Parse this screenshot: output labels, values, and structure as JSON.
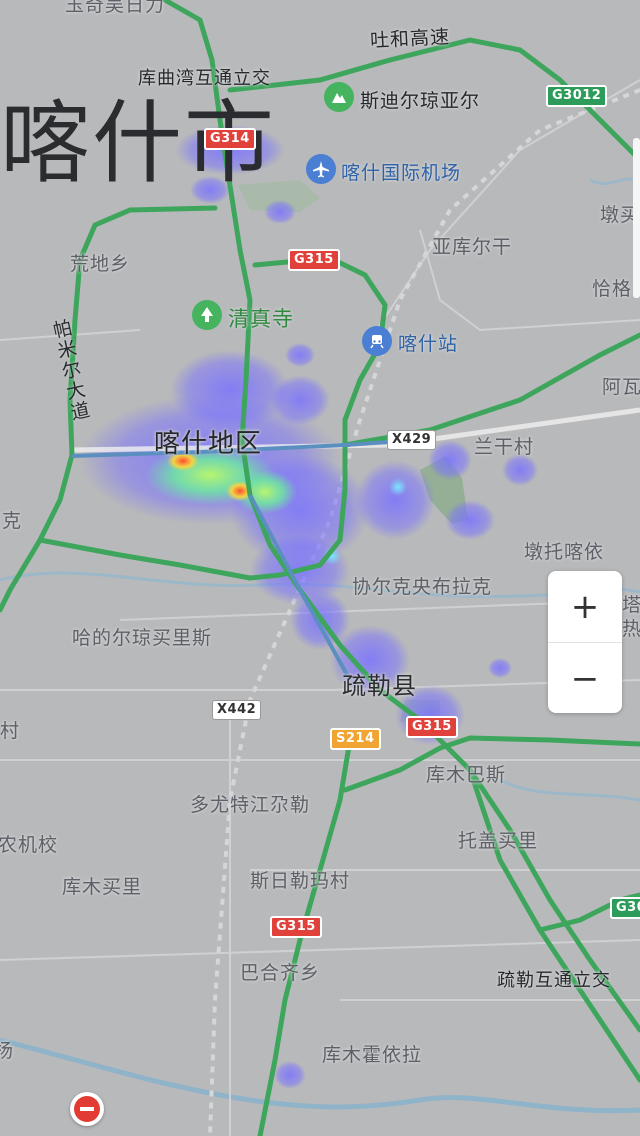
{
  "city_label": "喀什市",
  "district_label": "喀什地区",
  "county_label": "疏勒县",
  "colors": {
    "background": "#b8b9bb",
    "highway": "#3ba55c",
    "road": "#dcdcdc",
    "river": "#8fb3c9",
    "heat_low": "#7a72ff",
    "heat_mid": "#8cf08c",
    "heat_high": "#ff5a3a"
  },
  "road_labels": {
    "tuhe_expressway": "吐和高速",
    "pamir_avenue": "帕米尔大道",
    "kuqu_interchange": "库曲湾互通立交",
    "shule_interchange": "疏勒互通立交"
  },
  "shields": {
    "g314": "G314",
    "g3012": "G3012",
    "g315_top": "G315",
    "x429": "X429",
    "x442": "X442",
    "s214": "S214",
    "g315_mid": "G315",
    "g315_low": "G315",
    "g30": "G30"
  },
  "pois": {
    "sidierqiong": "斯迪尔琼亚尔",
    "airport": "喀什国际机场",
    "mosque": "清真寺",
    "station": "喀什站"
  },
  "places": {
    "top_cut": "玉奇吴日力",
    "huangdi": "荒地乡",
    "yakuergan": "亚库尔干",
    "dun_right": "墩买",
    "qia_right": "恰格",
    "awa_right": "阿瓦",
    "langan": "兰干村",
    "dunto": "墩托喀依",
    "xieer": "协尔克央布拉克",
    "hadeer": "哈的尔琼买里斯",
    "ta_right": "塔",
    "re_right": "热",
    "likecut": "里克",
    "cun_left": "村",
    "kumubasi": "库木巴斯",
    "duoyou": "多尤特江尕勒",
    "agri": "农机校",
    "tuogai": "托盖买里",
    "kumumai": "库木买里",
    "siri": "斯日勒玛村",
    "bahe": "巴合齐乡",
    "kumuhuo": "库木霍依拉",
    "yang_left": "扬"
  },
  "zoom": {
    "in_label": "+",
    "out_label": "−"
  },
  "icons": {
    "sidierqiong": "mountain-icon",
    "airport": "airplane-icon",
    "mosque": "tree-icon",
    "station": "train-icon",
    "no_entry": "no-entry-icon"
  }
}
